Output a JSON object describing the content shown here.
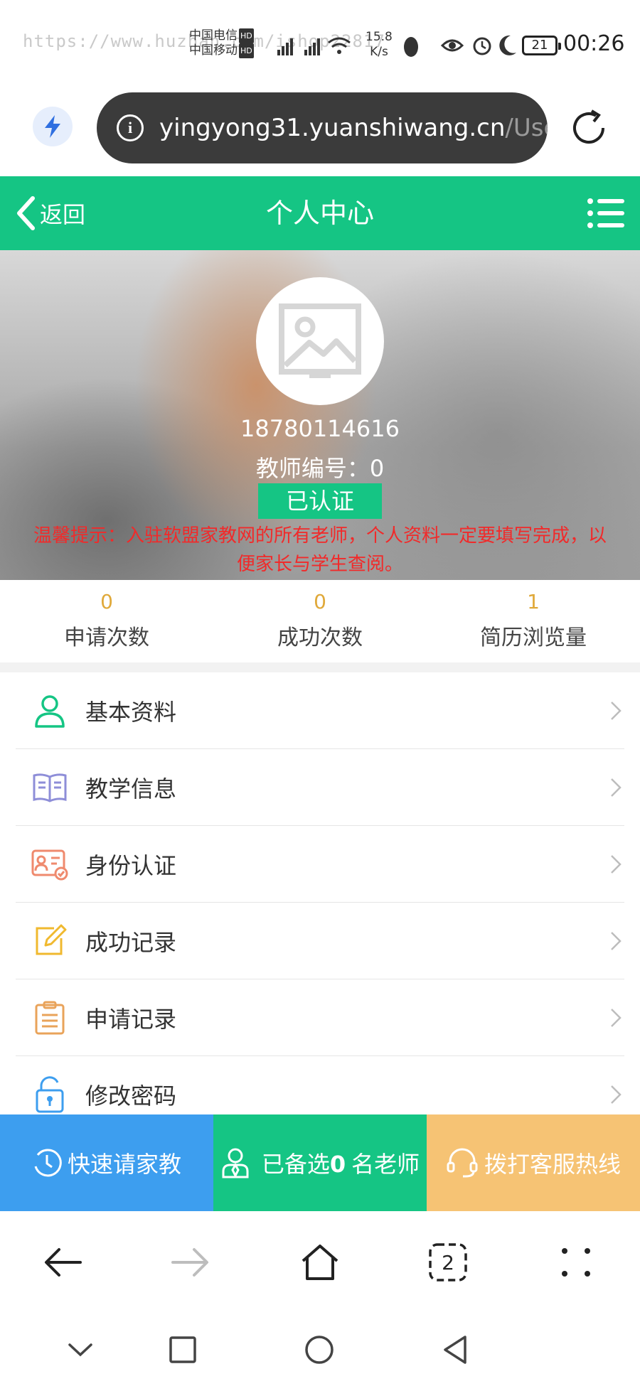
{
  "status_bar": {
    "watermark": "https://www.huzhan.com/ishop22817",
    "carrier_1": "中国电信",
    "carrier_2": "中国移动",
    "hd": "HD",
    "speed_value": "15.8",
    "speed_unit": "K/s",
    "battery": "21",
    "time": "00:26"
  },
  "browser": {
    "url_main": "yingyong31.yuanshiwang.cn",
    "url_path": "/User/",
    "tab_count": "2"
  },
  "header": {
    "back_label": "返回",
    "title": "个人中心"
  },
  "profile": {
    "phone": "18780114616",
    "teacher_no_label": "教师编号：",
    "teacher_no": "0",
    "verified_label": "已认证",
    "tip_line1": "温馨提示：入驻软盟家教网的所有老师，个人资料一定要填写完成，以",
    "tip_line2": "便家长与学生查阅。"
  },
  "stats": [
    {
      "value": "0",
      "label": "申请次数"
    },
    {
      "value": "0",
      "label": "成功次数"
    },
    {
      "value": "1",
      "label": "简历浏览量"
    }
  ],
  "menu": [
    {
      "label": "基本资料",
      "icon": "user-icon",
      "color": "#15c584"
    },
    {
      "label": "教学信息",
      "icon": "book-icon",
      "color": "#8e8ed8"
    },
    {
      "label": "身份认证",
      "icon": "id-card-icon",
      "color": "#ef8a6e"
    },
    {
      "label": "成功记录",
      "icon": "edit-icon",
      "color": "#f0b92f"
    },
    {
      "label": "申请记录",
      "icon": "clipboard-icon",
      "color": "#e9a35a"
    },
    {
      "label": "修改密码",
      "icon": "lock-icon",
      "color": "#3d9eef"
    }
  ],
  "actions": {
    "quick_label": "快速请家教",
    "selected_prefix": "已备选",
    "selected_count": "0",
    "selected_suffix": "名老师",
    "hotline_label": "拨打客服热线"
  },
  "colors": {
    "brand_green": "#15c584",
    "blue": "#3d9eef",
    "orange": "#f6c374",
    "tip_red": "#f12a2a",
    "stat_gold": "#e0a93a"
  }
}
